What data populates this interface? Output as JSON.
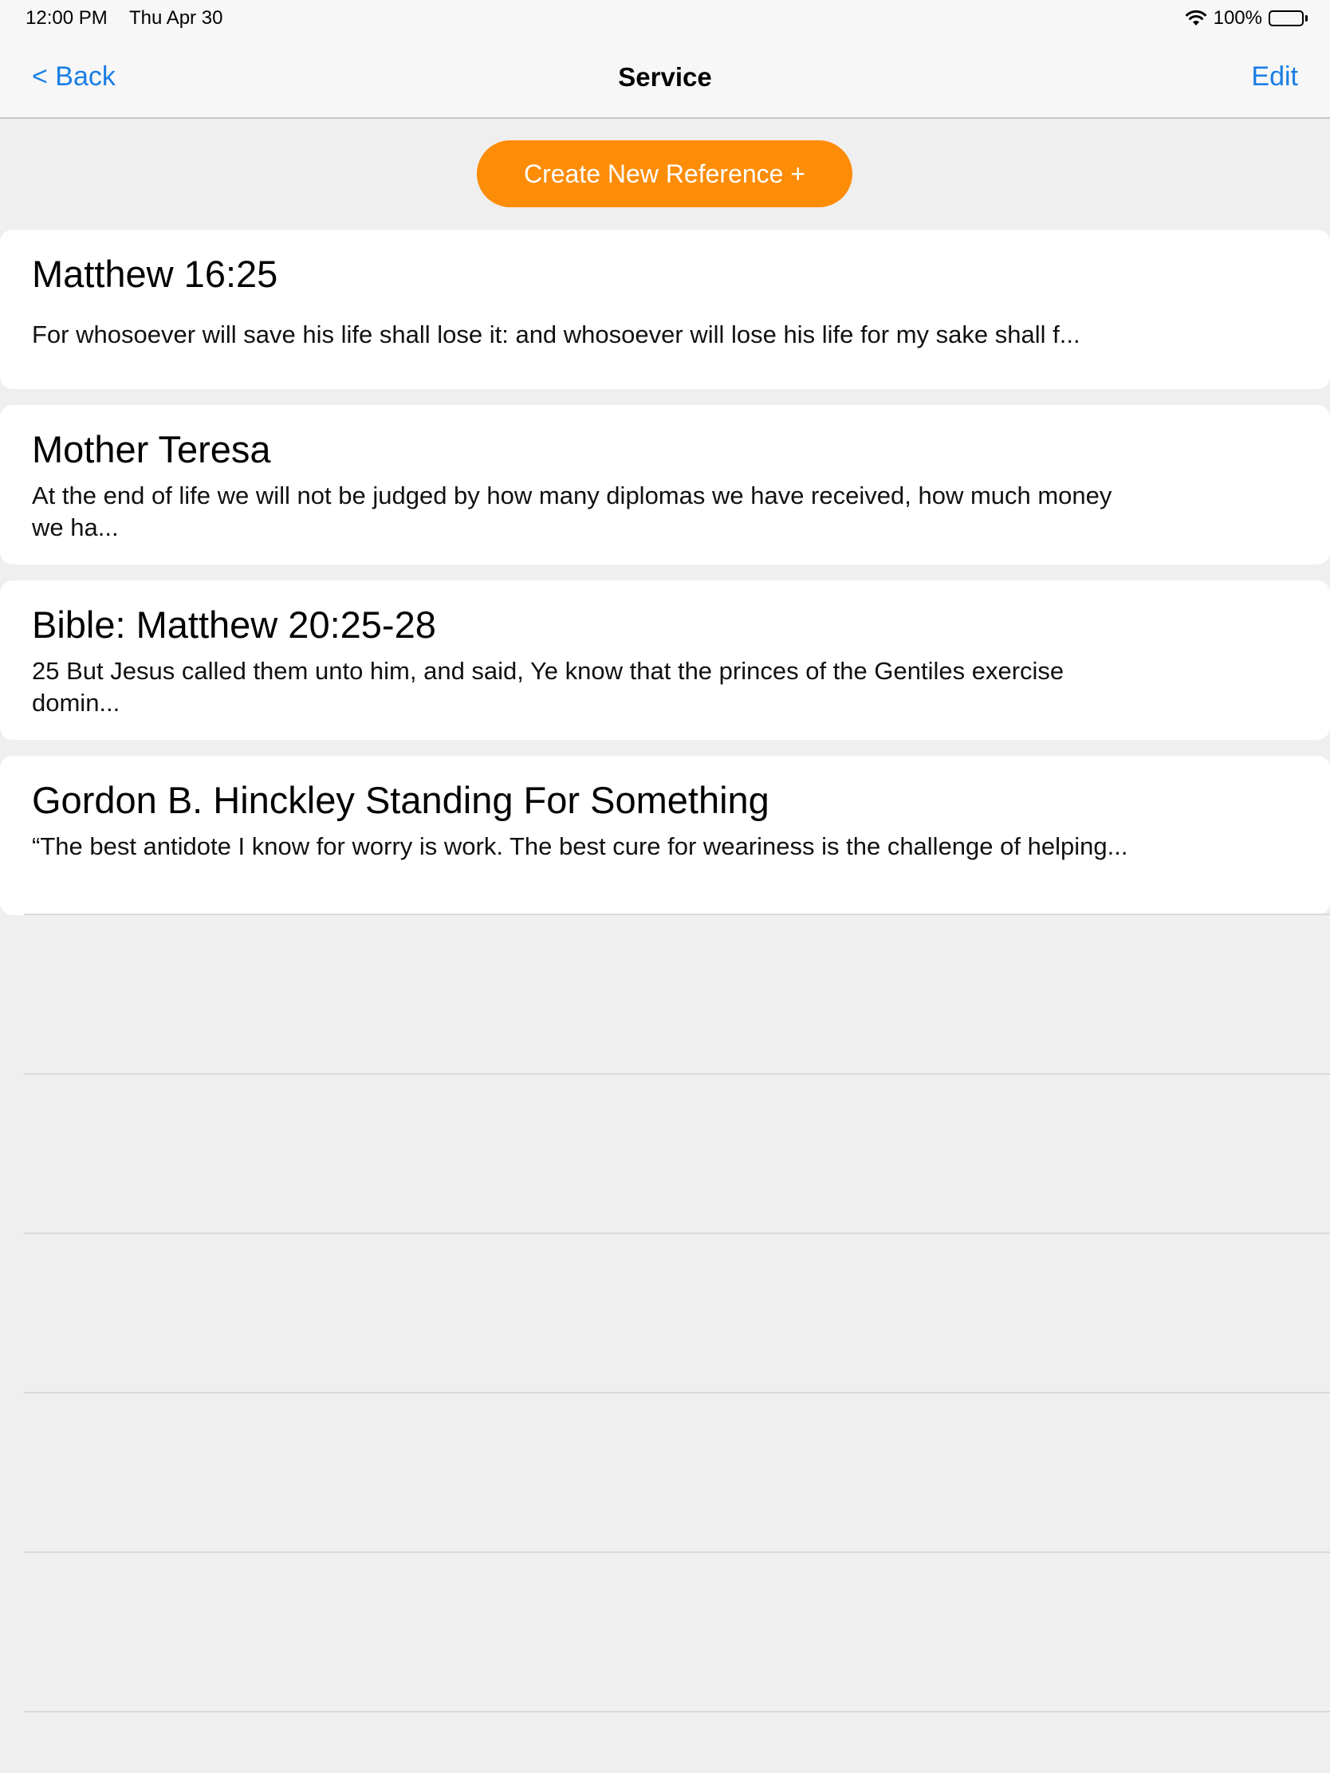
{
  "status_bar": {
    "time": "12:00 PM",
    "date": "Thu Apr 30",
    "battery": "100%",
    "battery_level": 1.0,
    "wifi_icon": "wifi-icon",
    "battery_icon": "battery-icon"
  },
  "nav": {
    "back_label": "< Back",
    "title": "Service",
    "edit_label": "Edit"
  },
  "create_button": {
    "label": "Create New Reference +",
    "color": "#fd8c07"
  },
  "references": [
    {
      "title": "Matthew 16:25",
      "excerpt": "For whosoever will save his life shall lose it: and whosoever will lose his life for my sake shall f..."
    },
    {
      "title": "Mother Teresa",
      "excerpt": "At the end of life we will not be judged by how many diplomas we have received, how much money we ha..."
    },
    {
      "title": "Bible: Matthew 20:25-28",
      "excerpt": "25 But Jesus called them unto him, and said, Ye know that the princes of the Gentiles exercise domin..."
    },
    {
      "title": "Gordon B. Hinckley Standing For Something",
      "excerpt": "“The best antidote I know for worry is work. The best cure for weariness is the challenge of helping..."
    }
  ],
  "colors": {
    "accent": "#1a7ee6",
    "background": "#efeff0"
  }
}
